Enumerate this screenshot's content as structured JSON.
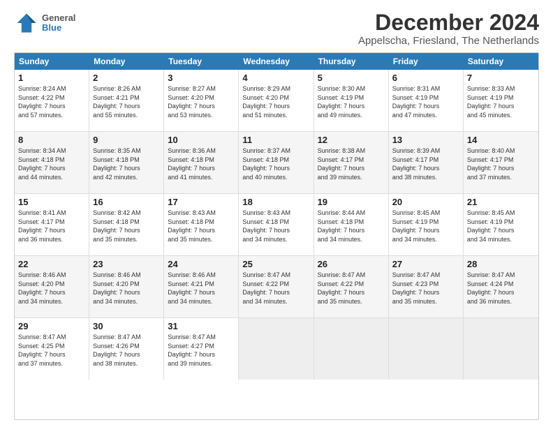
{
  "logo": {
    "line1": "General",
    "line2": "Blue"
  },
  "title": "December 2024",
  "subtitle": "Appelscha, Friesland, The Netherlands",
  "weekdays": [
    "Sunday",
    "Monday",
    "Tuesday",
    "Wednesday",
    "Thursday",
    "Friday",
    "Saturday"
  ],
  "weeks": [
    [
      {
        "day": "1",
        "info": "Sunrise: 8:24 AM\nSunset: 4:22 PM\nDaylight: 7 hours\nand 57 minutes."
      },
      {
        "day": "2",
        "info": "Sunrise: 8:26 AM\nSunset: 4:21 PM\nDaylight: 7 hours\nand 55 minutes."
      },
      {
        "day": "3",
        "info": "Sunrise: 8:27 AM\nSunset: 4:20 PM\nDaylight: 7 hours\nand 53 minutes."
      },
      {
        "day": "4",
        "info": "Sunrise: 8:29 AM\nSunset: 4:20 PM\nDaylight: 7 hours\nand 51 minutes."
      },
      {
        "day": "5",
        "info": "Sunrise: 8:30 AM\nSunset: 4:19 PM\nDaylight: 7 hours\nand 49 minutes."
      },
      {
        "day": "6",
        "info": "Sunrise: 8:31 AM\nSunset: 4:19 PM\nDaylight: 7 hours\nand 47 minutes."
      },
      {
        "day": "7",
        "info": "Sunrise: 8:33 AM\nSunset: 4:19 PM\nDaylight: 7 hours\nand 45 minutes."
      }
    ],
    [
      {
        "day": "8",
        "info": "Sunrise: 8:34 AM\nSunset: 4:18 PM\nDaylight: 7 hours\nand 44 minutes."
      },
      {
        "day": "9",
        "info": "Sunrise: 8:35 AM\nSunset: 4:18 PM\nDaylight: 7 hours\nand 42 minutes."
      },
      {
        "day": "10",
        "info": "Sunrise: 8:36 AM\nSunset: 4:18 PM\nDaylight: 7 hours\nand 41 minutes."
      },
      {
        "day": "11",
        "info": "Sunrise: 8:37 AM\nSunset: 4:18 PM\nDaylight: 7 hours\nand 40 minutes."
      },
      {
        "day": "12",
        "info": "Sunrise: 8:38 AM\nSunset: 4:17 PM\nDaylight: 7 hours\nand 39 minutes."
      },
      {
        "day": "13",
        "info": "Sunrise: 8:39 AM\nSunset: 4:17 PM\nDaylight: 7 hours\nand 38 minutes."
      },
      {
        "day": "14",
        "info": "Sunrise: 8:40 AM\nSunset: 4:17 PM\nDaylight: 7 hours\nand 37 minutes."
      }
    ],
    [
      {
        "day": "15",
        "info": "Sunrise: 8:41 AM\nSunset: 4:17 PM\nDaylight: 7 hours\nand 36 minutes."
      },
      {
        "day": "16",
        "info": "Sunrise: 8:42 AM\nSunset: 4:18 PM\nDaylight: 7 hours\nand 35 minutes."
      },
      {
        "day": "17",
        "info": "Sunrise: 8:43 AM\nSunset: 4:18 PM\nDaylight: 7 hours\nand 35 minutes."
      },
      {
        "day": "18",
        "info": "Sunrise: 8:43 AM\nSunset: 4:18 PM\nDaylight: 7 hours\nand 34 minutes."
      },
      {
        "day": "19",
        "info": "Sunrise: 8:44 AM\nSunset: 4:18 PM\nDaylight: 7 hours\nand 34 minutes."
      },
      {
        "day": "20",
        "info": "Sunrise: 8:45 AM\nSunset: 4:19 PM\nDaylight: 7 hours\nand 34 minutes."
      },
      {
        "day": "21",
        "info": "Sunrise: 8:45 AM\nSunset: 4:19 PM\nDaylight: 7 hours\nand 34 minutes."
      }
    ],
    [
      {
        "day": "22",
        "info": "Sunrise: 8:46 AM\nSunset: 4:20 PM\nDaylight: 7 hours\nand 34 minutes."
      },
      {
        "day": "23",
        "info": "Sunrise: 8:46 AM\nSunset: 4:20 PM\nDaylight: 7 hours\nand 34 minutes."
      },
      {
        "day": "24",
        "info": "Sunrise: 8:46 AM\nSunset: 4:21 PM\nDaylight: 7 hours\nand 34 minutes."
      },
      {
        "day": "25",
        "info": "Sunrise: 8:47 AM\nSunset: 4:22 PM\nDaylight: 7 hours\nand 34 minutes."
      },
      {
        "day": "26",
        "info": "Sunrise: 8:47 AM\nSunset: 4:22 PM\nDaylight: 7 hours\nand 35 minutes."
      },
      {
        "day": "27",
        "info": "Sunrise: 8:47 AM\nSunset: 4:23 PM\nDaylight: 7 hours\nand 35 minutes."
      },
      {
        "day": "28",
        "info": "Sunrise: 8:47 AM\nSunset: 4:24 PM\nDaylight: 7 hours\nand 36 minutes."
      }
    ],
    [
      {
        "day": "29",
        "info": "Sunrise: 8:47 AM\nSunset: 4:25 PM\nDaylight: 7 hours\nand 37 minutes."
      },
      {
        "day": "30",
        "info": "Sunrise: 8:47 AM\nSunset: 4:26 PM\nDaylight: 7 hours\nand 38 minutes."
      },
      {
        "day": "31",
        "info": "Sunrise: 8:47 AM\nSunset: 4:27 PM\nDaylight: 7 hours\nand 39 minutes."
      },
      {
        "day": "",
        "info": ""
      },
      {
        "day": "",
        "info": ""
      },
      {
        "day": "",
        "info": ""
      },
      {
        "day": "",
        "info": ""
      }
    ]
  ]
}
